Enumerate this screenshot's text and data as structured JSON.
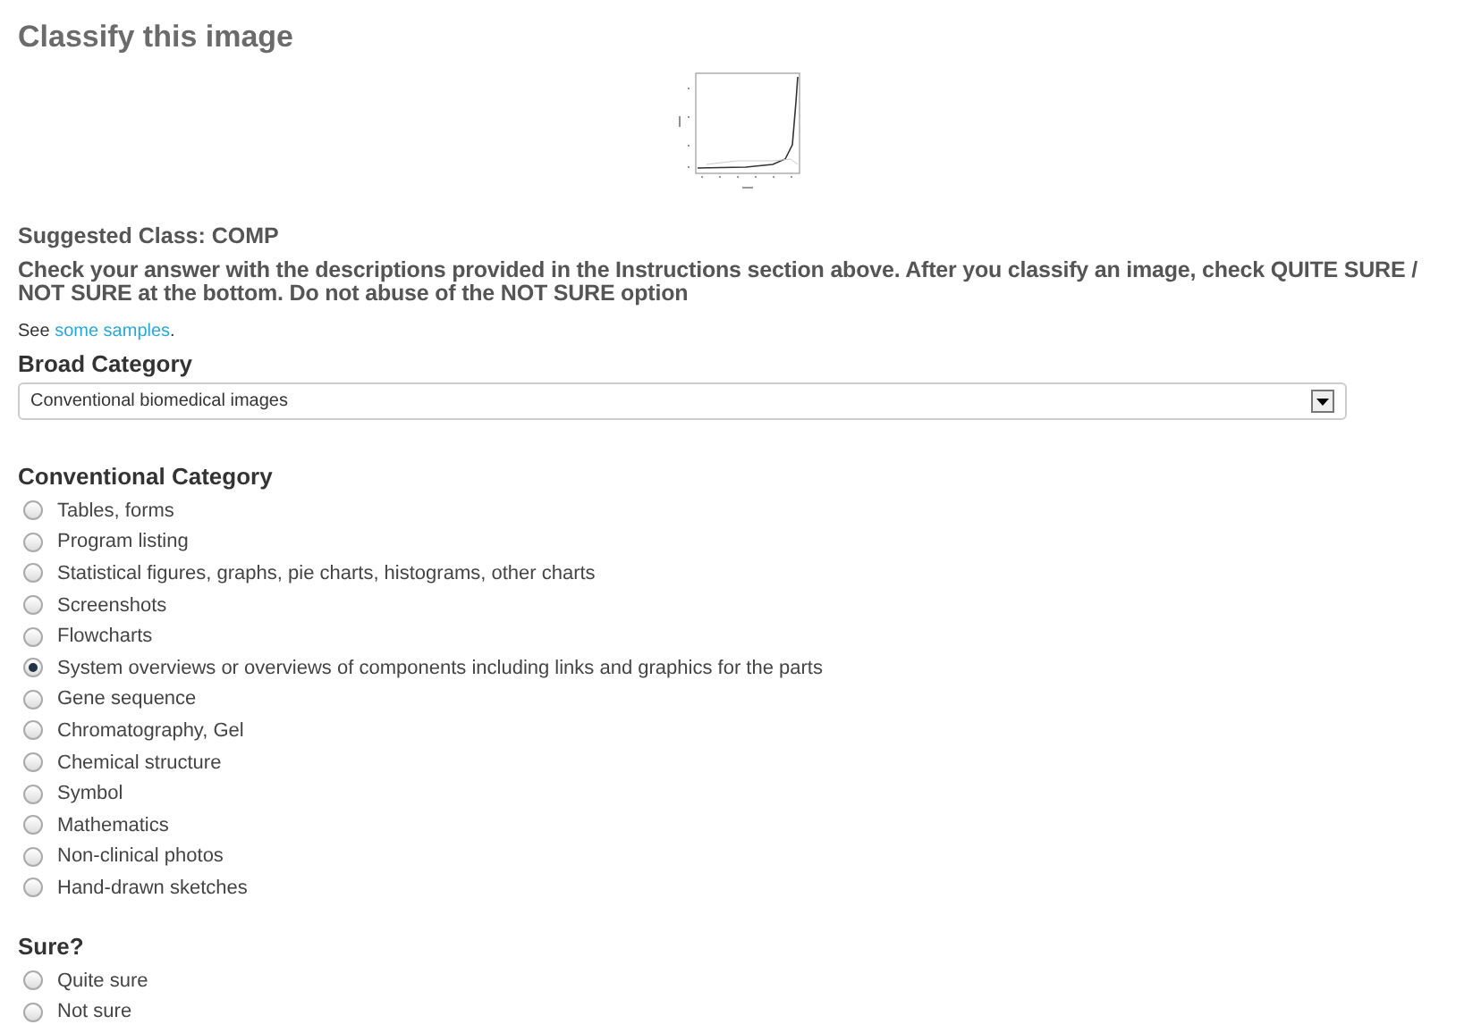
{
  "title": "Classify this image",
  "suggested_class": "Suggested Class: COMP",
  "instructions": "Check your answer with the descriptions provided in the Instructions section above. After you classify an image, check QUITE SURE / NOT SURE at the bottom. Do not abuse of the NOT SURE option",
  "samples": {
    "prefix": "See ",
    "link": "some samples",
    "suffix": "."
  },
  "broad_category": {
    "label": "Broad Category",
    "value": "Conventional biomedical images"
  },
  "conventional_category": {
    "label": "Conventional Category",
    "options": [
      {
        "label": "Tables, forms",
        "selected": false
      },
      {
        "label": "Program listing",
        "selected": false
      },
      {
        "label": "Statistical figures, graphs, pie charts, histograms, other charts",
        "selected": false
      },
      {
        "label": "Screenshots",
        "selected": false
      },
      {
        "label": "Flowcharts",
        "selected": false
      },
      {
        "label": "System overviews or overviews of components including links and graphics for the parts",
        "selected": true
      },
      {
        "label": "Gene sequence",
        "selected": false
      },
      {
        "label": "Chromatography, Gel",
        "selected": false
      },
      {
        "label": "Chemical structure",
        "selected": false
      },
      {
        "label": "Symbol",
        "selected": false
      },
      {
        "label": "Mathematics",
        "selected": false
      },
      {
        "label": "Non-clinical photos",
        "selected": false
      },
      {
        "label": "Hand-drawn sketches",
        "selected": false
      }
    ]
  },
  "sure": {
    "label": "Sure?",
    "options": [
      {
        "label": "Quite sure",
        "selected": false
      },
      {
        "label": "Not sure",
        "selected": false
      }
    ]
  }
}
